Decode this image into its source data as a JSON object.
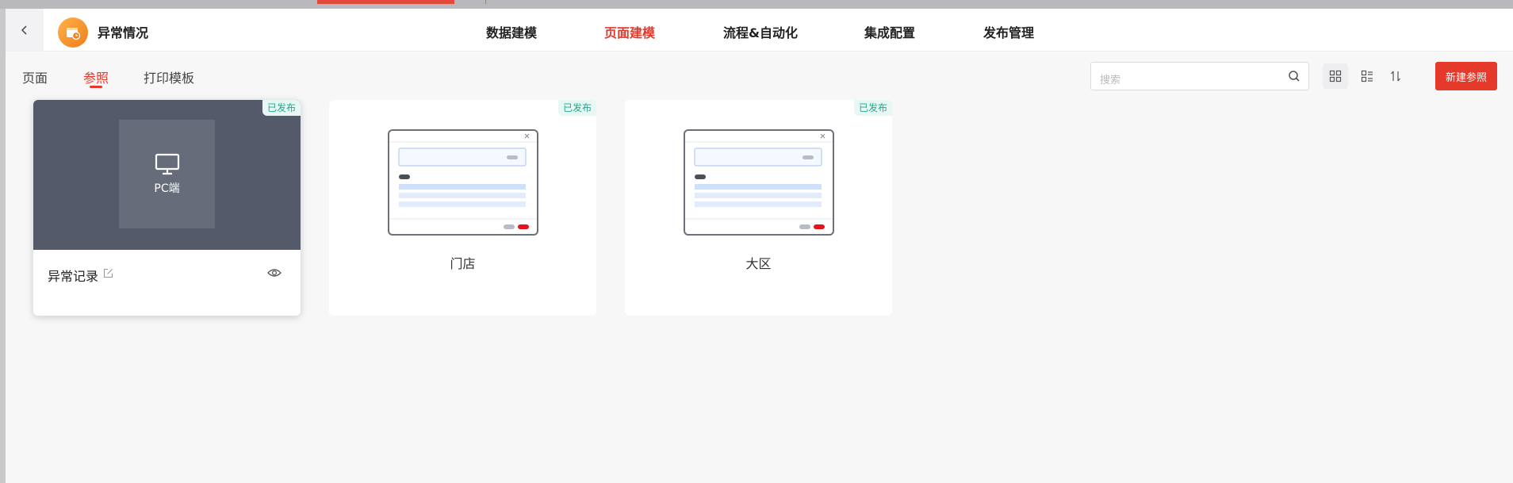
{
  "app": {
    "title": "异常情况"
  },
  "nav": [
    "数据建模",
    "页面建模",
    "流程&自动化",
    "集成配置",
    "发布管理"
  ],
  "nav_active": "页面建模",
  "tabs": [
    "页面",
    "参照",
    "打印模板"
  ],
  "tab_active": "参照",
  "search": {
    "placeholder": "搜索"
  },
  "toolbar": {
    "new_label": "新建参照"
  },
  "cards": [
    {
      "name": "异常记录",
      "status": "已发布",
      "thumb_label": "PC端"
    },
    {
      "name": "门店",
      "status": "已发布"
    },
    {
      "name": "大区",
      "status": "已发布"
    }
  ],
  "colors": {
    "accent": "#e5392c",
    "published": "#21a88e",
    "thumb_dark": "#545a69"
  }
}
